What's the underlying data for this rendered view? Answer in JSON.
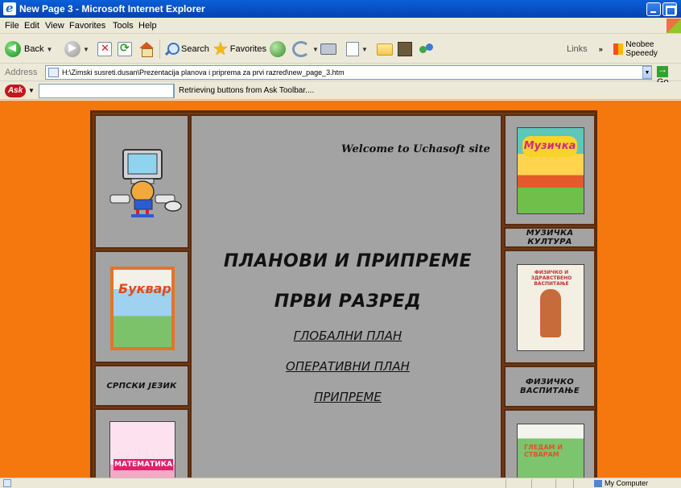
{
  "window": {
    "title": "New Page 3 - Microsoft Internet Explorer"
  },
  "menu": [
    "File",
    "Edit",
    "View",
    "Favorites",
    "Tools",
    "Help"
  ],
  "toolbar": {
    "back_label": "Back",
    "search_label": "Search",
    "favorites_label": "Favorites",
    "links_label": "Links",
    "extra_label": "Neobee Speeedy"
  },
  "address": {
    "label": "Address",
    "value": "H:\\Zimski susreti.dusan\\Prezentacija planova i priprema za prvi razred\\new_page_3.htm",
    "go_label": "Go"
  },
  "ask_toolbar": {
    "logo": "Ask",
    "status": "Retrieving buttons from Ask Toolbar...."
  },
  "page": {
    "welcome": "Welcome to Uchasoft site",
    "heading1": "ПЛАНОВИ И ПРИПРЕМЕ",
    "heading2": "ПРВИ РАЗРЕД",
    "links": [
      "ГЛОБАЛНИ ПЛАН",
      "ОПЕРАТИВНИ ПЛАН",
      "ПРИПРЕМЕ"
    ],
    "left_labels": [
      "СРПСКИ ЈЕЗИК"
    ],
    "right_labels": [
      "МУЗИЧКА КУЛТУРА",
      "ФИЗИЧКО ВАСПИТАЊЕ"
    ],
    "books": {
      "music_title": "Музичка",
      "bukvar_title": "Буквар",
      "pe_title": "ФИЗИЧКО И ЗДРАВСТВЕНО ВАСПИТАЊЕ",
      "math_title": "МАТЕМАТИКА",
      "read_title": "ГЛЕДАМ И СТВАРАМ"
    }
  },
  "statusbar": {
    "zone": "My Computer"
  },
  "colors": {
    "page_bg": "#f5780f",
    "panel_bg": "#a3a3a3",
    "border": "#5a2b0d",
    "titlebar": "#0a5fd8"
  }
}
